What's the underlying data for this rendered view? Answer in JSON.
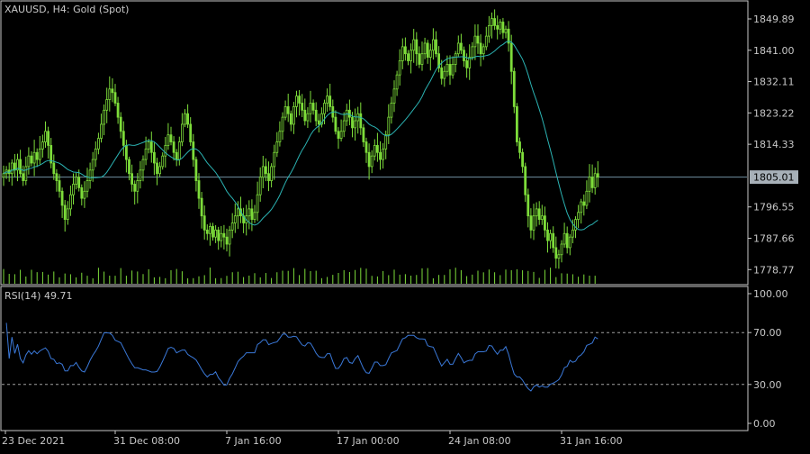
{
  "window": {
    "symbol_label": "XAUUSD, H4:  Gold (Spot)"
  },
  "colors": {
    "background": "#000000",
    "frame": "#c8c8c8",
    "text": "#c8c8c8",
    "candle": "#7ddc3a",
    "ma": "#2bb3b3",
    "rsi": "#3a78d8",
    "price_line": "#6f8fa0",
    "price_label_bg": "#a7b0b8",
    "price_label_text": "#000000"
  },
  "chart_data": {
    "type": "candlestick",
    "price_axis": {
      "labels": [
        "1849.89",
        "1841.00",
        "1832.11",
        "1823.22",
        "1814.33",
        "1805.01",
        "1796.55",
        "1787.66",
        "1778.77"
      ],
      "values": [
        1849.89,
        1841.0,
        1832.11,
        1823.22,
        1814.33,
        1805.01,
        1796.55,
        1787.66,
        1778.77
      ],
      "range": [
        1774.5,
        1855.0
      ]
    },
    "current_price": {
      "label": "1805.01",
      "value": 1805.01
    },
    "time_axis": {
      "labels": [
        "23 Dec 2021",
        "31 Dec 08:00",
        "7 Jan 16:00",
        "17 Jan 00:00",
        "24 Jan 08:00",
        "31 Jan 16:00"
      ],
      "positions": [
        0,
        40,
        80,
        120,
        160,
        200
      ]
    },
    "candle_count": 210,
    "close": [
      1806,
      1807,
      1806,
      1809,
      1807,
      1810,
      1806,
      1804,
      1808,
      1811,
      1809,
      1812,
      1810,
      1813,
      1815,
      1818,
      1814,
      1809,
      1806,
      1804,
      1801,
      1797,
      1793,
      1796,
      1800,
      1803,
      1805,
      1802,
      1799,
      1801,
      1804,
      1807,
      1810,
      1813,
      1816,
      1820,
      1824,
      1827,
      1830,
      1829,
      1826,
      1822,
      1818,
      1814,
      1810,
      1806,
      1803,
      1801,
      1804,
      1807,
      1810,
      1813,
      1815,
      1812,
      1809,
      1806,
      1808,
      1811,
      1814,
      1817,
      1815,
      1812,
      1810,
      1815,
      1820,
      1823,
      1820,
      1815,
      1810,
      1804,
      1799,
      1794,
      1790,
      1789,
      1791,
      1788,
      1790,
      1787,
      1789,
      1788,
      1786,
      1790,
      1792,
      1794,
      1796,
      1794,
      1792,
      1794,
      1796,
      1793,
      1795,
      1800,
      1805,
      1808,
      1806,
      1804,
      1808,
      1812,
      1815,
      1818,
      1822,
      1825,
      1823,
      1820,
      1825,
      1828,
      1826,
      1824,
      1821,
      1823,
      1826,
      1824,
      1821,
      1820,
      1823,
      1826,
      1828,
      1825,
      1822,
      1818,
      1816,
      1818,
      1821,
      1824,
      1822,
      1819,
      1821,
      1823,
      1819,
      1815,
      1812,
      1808,
      1811,
      1814,
      1812,
      1810,
      1813,
      1817,
      1822,
      1826,
      1830,
      1834,
      1838,
      1842,
      1840,
      1838,
      1841,
      1844,
      1840,
      1837,
      1840,
      1843,
      1839,
      1841,
      1844,
      1840,
      1836,
      1833,
      1835,
      1837,
      1834,
      1837,
      1840,
      1843,
      1841,
      1838,
      1836,
      1839,
      1842,
      1845,
      1843,
      1840,
      1842,
      1845,
      1848,
      1850,
      1848,
      1847,
      1849,
      1846,
      1847,
      1843,
      1835,
      1825,
      1815,
      1812,
      1808,
      1800,
      1794,
      1790,
      1794,
      1796,
      1793,
      1794,
      1790,
      1787,
      1789,
      1785,
      1782,
      1783,
      1786,
      1789,
      1785,
      1788,
      1790,
      1793,
      1795,
      1798,
      1797,
      1801,
      1805,
      1802,
      1806,
      1805
    ],
    "ma_period": 20,
    "rsi_panel": {
      "label": "RSI(14) 49.71",
      "value": 49.71,
      "levels": [
        70,
        30
      ],
      "axis_labels": [
        "100.00",
        "70.00",
        "30.00",
        "0.00"
      ],
      "axis_values": [
        100,
        70,
        30,
        0
      ],
      "range": [
        0,
        100
      ]
    }
  }
}
